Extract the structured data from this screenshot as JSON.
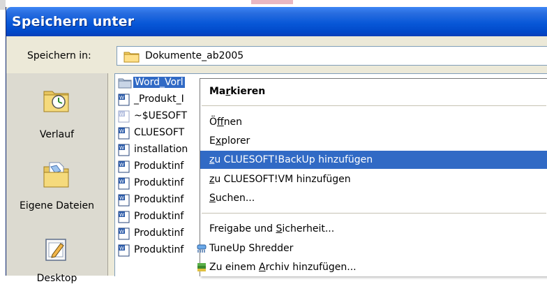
{
  "dialog": {
    "title": "Speichern unter",
    "save_in_label": "Speichern in:",
    "save_in_value": "Dokumente_ab2005"
  },
  "places": [
    {
      "label": "Verlauf",
      "icon": "history-icon"
    },
    {
      "label": "Eigene Dateien",
      "icon": "my-documents-icon"
    },
    {
      "label": "Desktop",
      "icon": "desktop-icon"
    }
  ],
  "files": [
    {
      "name": "Word_Vorl",
      "icon": "folder-icon",
      "selected": true
    },
    {
      "name": "_Produkt_I",
      "icon": "word-doc-icon"
    },
    {
      "name": "~$UESOFT",
      "icon": "word-temp-icon"
    },
    {
      "name": "CLUESOFT",
      "icon": "word-doc-icon"
    },
    {
      "name": "installation",
      "icon": "word-doc-icon"
    },
    {
      "name": "Produktinf",
      "icon": "word-doc-icon"
    },
    {
      "name": "Produktinf",
      "icon": "word-doc-icon"
    },
    {
      "name": "Produktinf",
      "icon": "word-doc-icon"
    },
    {
      "name": "Produktinf",
      "icon": "word-doc-icon"
    },
    {
      "name": "Produktinf",
      "icon": "word-doc-icon"
    },
    {
      "name": "Produktinf",
      "icon": "word-doc-icon"
    }
  ],
  "context_menu": {
    "items": [
      {
        "pre": "Ma",
        "acc": "r",
        "post": "kieren",
        "bold": true
      },
      {
        "pre": "Ö",
        "acc": "f",
        "post": "fnen"
      },
      {
        "pre": "E",
        "acc": "x",
        "post": "plorer"
      },
      {
        "pre": "",
        "acc": "z",
        "post": "u CLUESOFT!BackUp hinzufügen",
        "highlighted": true
      },
      {
        "pre": "",
        "acc": "z",
        "post": "u CLUESOFT!VM hinzufügen"
      },
      {
        "pre": "",
        "acc": "S",
        "post": "uchen..."
      },
      {
        "pre": "Freigabe und ",
        "acc": "S",
        "post": "icherheit..."
      },
      {
        "pre": "TuneUp Shredder",
        "acc": "",
        "post": "",
        "icon": "tuneup-shredder-icon"
      },
      {
        "pre": "Zu einem ",
        "acc": "A",
        "post": "rchiv hinzufügen...",
        "icon": "winrar-archive-icon"
      }
    ]
  },
  "colors": {
    "title_bar": "#0858d8",
    "dialog_bg": "#ece9d8",
    "selection": "#316ac5"
  }
}
